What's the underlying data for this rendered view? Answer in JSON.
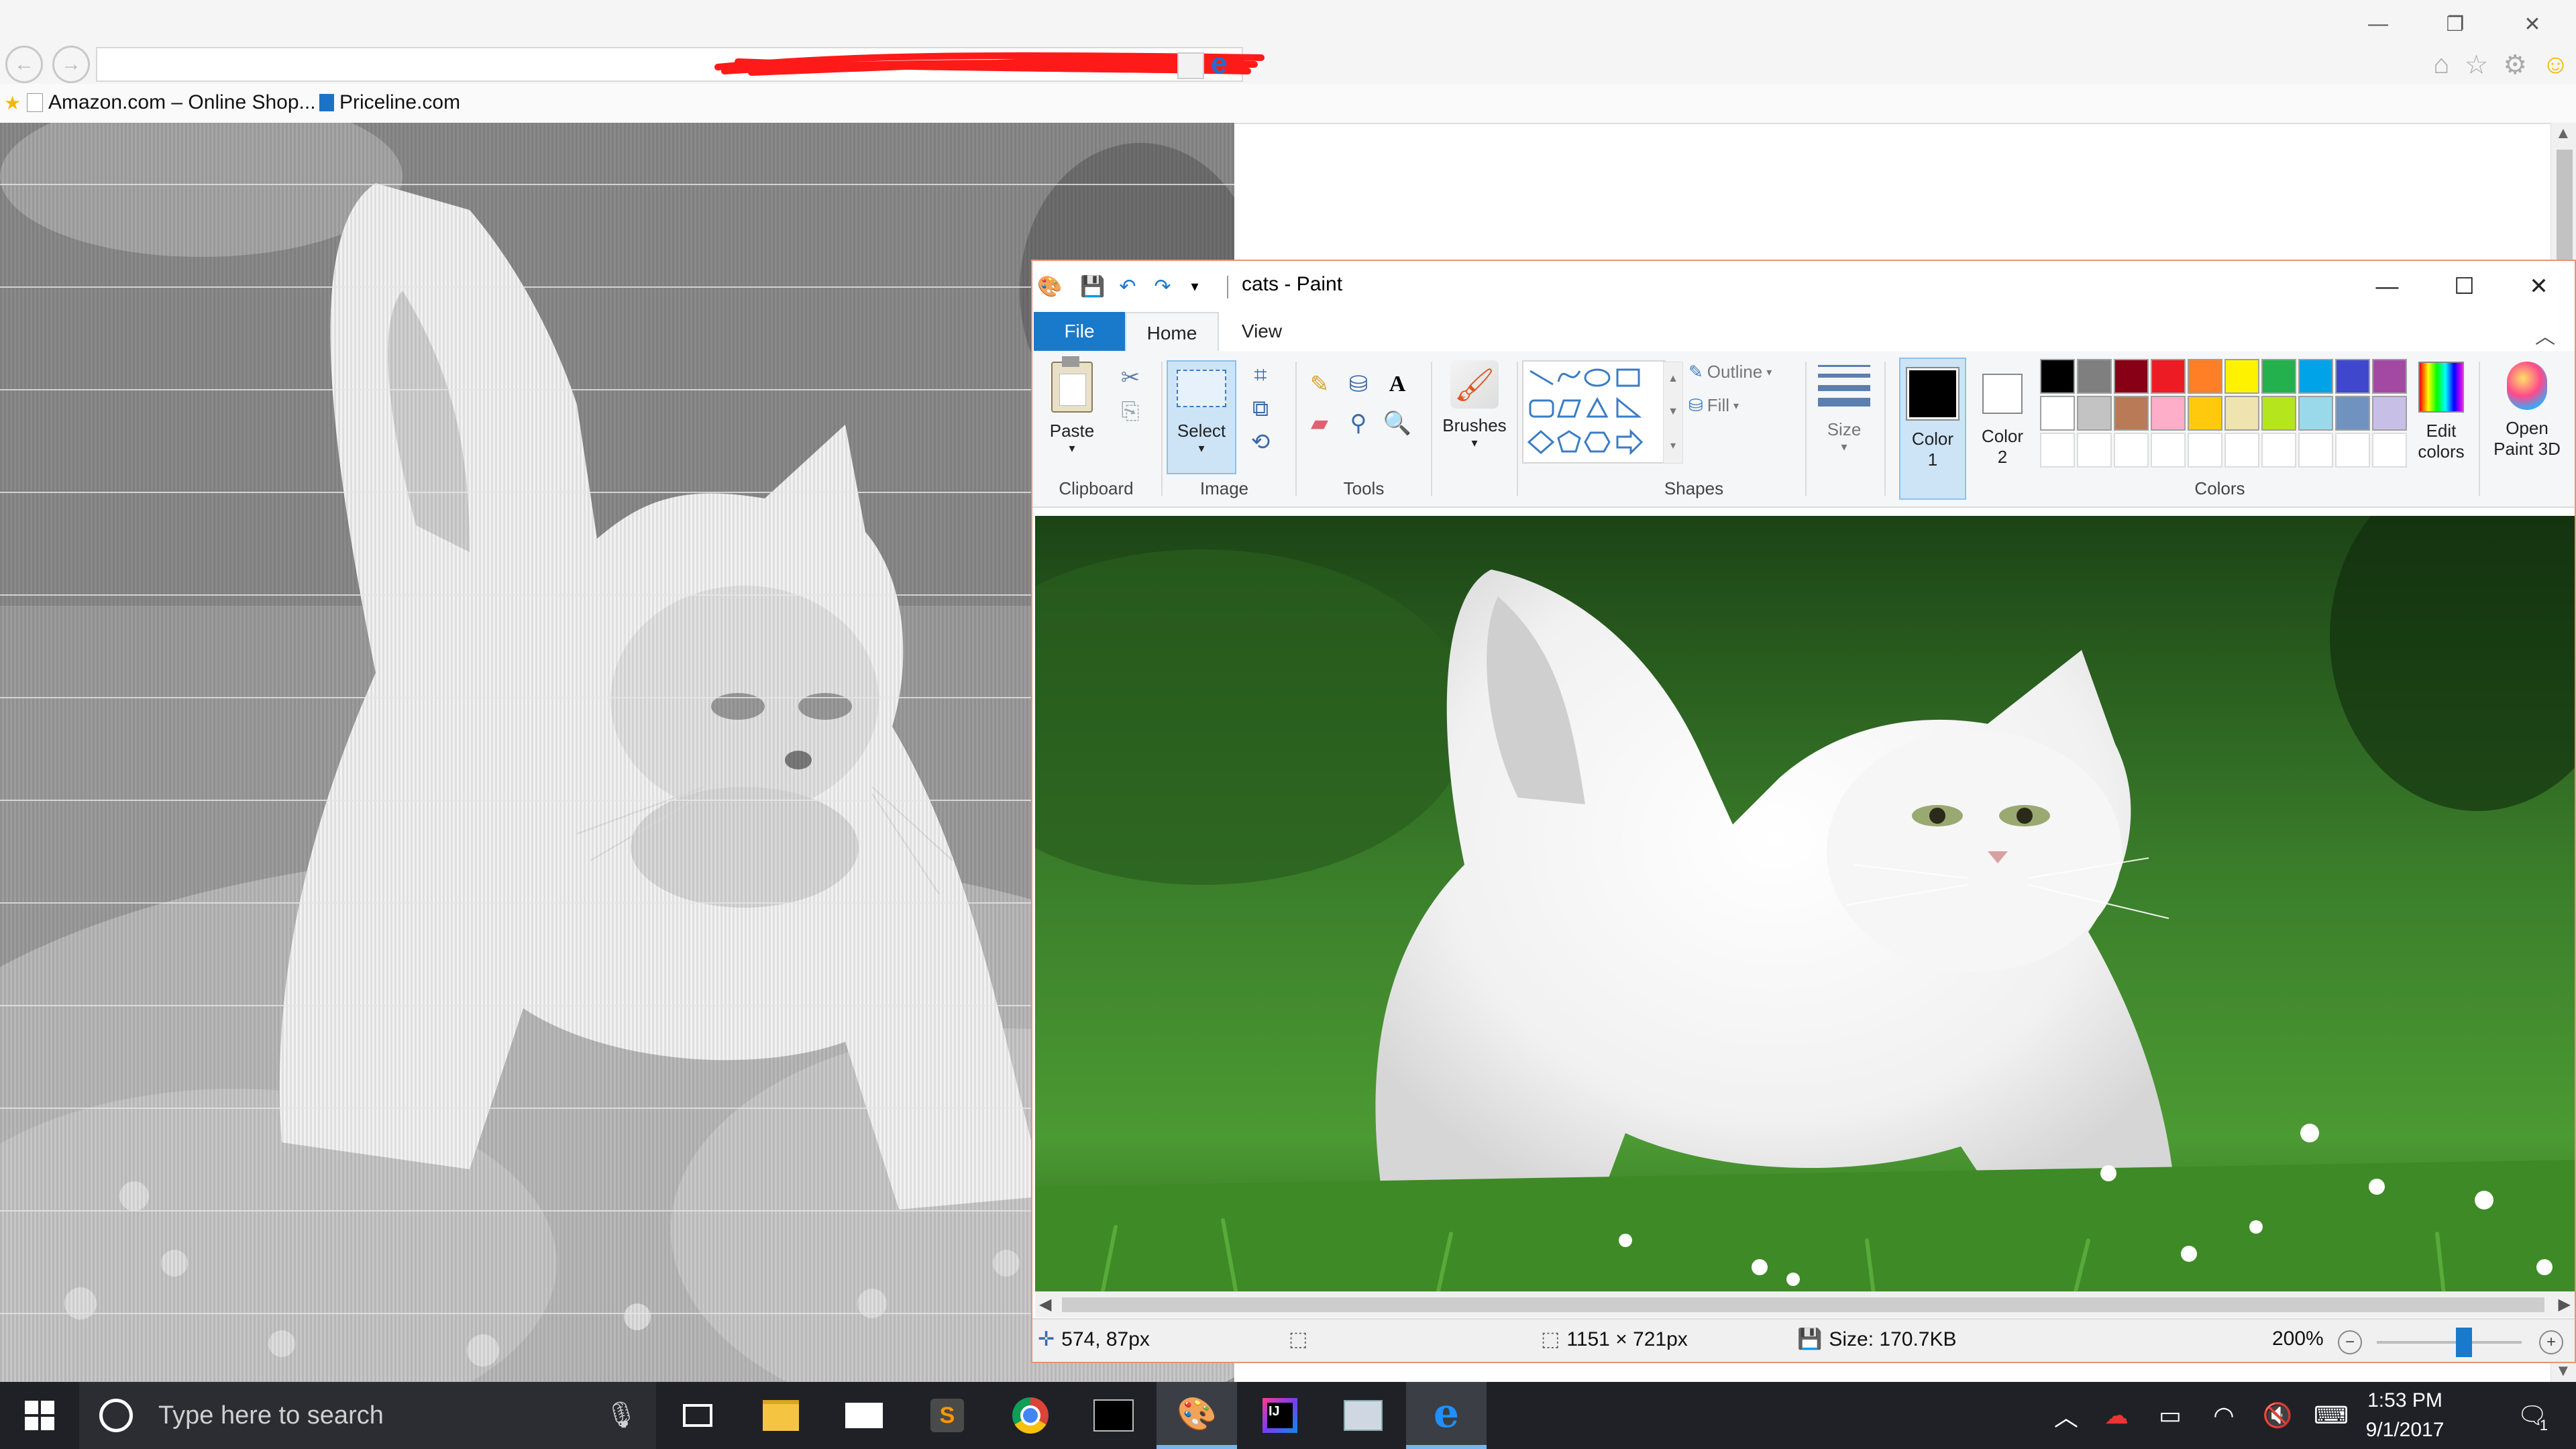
{
  "browser": {
    "favorites": [
      {
        "label": "Amazon.com – Online Shop..."
      },
      {
        "label": "Priceline.com"
      }
    ],
    "window_buttons": {
      "minimize": "—",
      "restore": "❐",
      "close": "✕"
    }
  },
  "paint": {
    "title": "cats - Paint",
    "tabs": {
      "file": "File",
      "home": "Home",
      "view": "View"
    },
    "ribbon": {
      "clipboard": {
        "paste": "Paste",
        "group": "Clipboard"
      },
      "image": {
        "select": "Select",
        "group": "Image"
      },
      "tools": {
        "group": "Tools"
      },
      "brushes": {
        "label": "Brushes"
      },
      "shapes": {
        "outline": "Outline",
        "fill": "Fill",
        "group": "Shapes"
      },
      "size": {
        "label": "Size"
      },
      "color1": {
        "line1": "Color",
        "line2": "1"
      },
      "color2": {
        "line1": "Color",
        "line2": "2"
      },
      "colors_group": "Colors",
      "edit_colors": {
        "line1": "Edit",
        "line2": "colors"
      },
      "open_paint3d": {
        "line1": "Open",
        "line2": "Paint 3D"
      },
      "palette_row1": [
        "#000000",
        "#7f7f7f",
        "#880015",
        "#ed1c24",
        "#ff7f27",
        "#fff200",
        "#22b14c",
        "#00a2e8",
        "#3f48cc",
        "#a349a4"
      ],
      "palette_row2": [
        "#ffffff",
        "#c3c3c3",
        "#b97a57",
        "#ffaec9",
        "#ffc90e",
        "#efe4b0",
        "#b5e61d",
        "#99d9ea",
        "#7092be",
        "#c8bfe7"
      ]
    },
    "status": {
      "cursor_pos": "574, 87px",
      "image_dims": "1151 × 721px",
      "file_size": "Size: 170.7KB",
      "zoom": "200%",
      "zoom_level": 0.6
    }
  },
  "taskbar": {
    "search_placeholder": "Type here to search",
    "time": "1:53 PM",
    "date": "9/1/2017",
    "notification_count": "1"
  },
  "colors": {
    "accent": "#1979ca",
    "taskbar": "#1f2126",
    "paint_border": "#e8927a"
  }
}
